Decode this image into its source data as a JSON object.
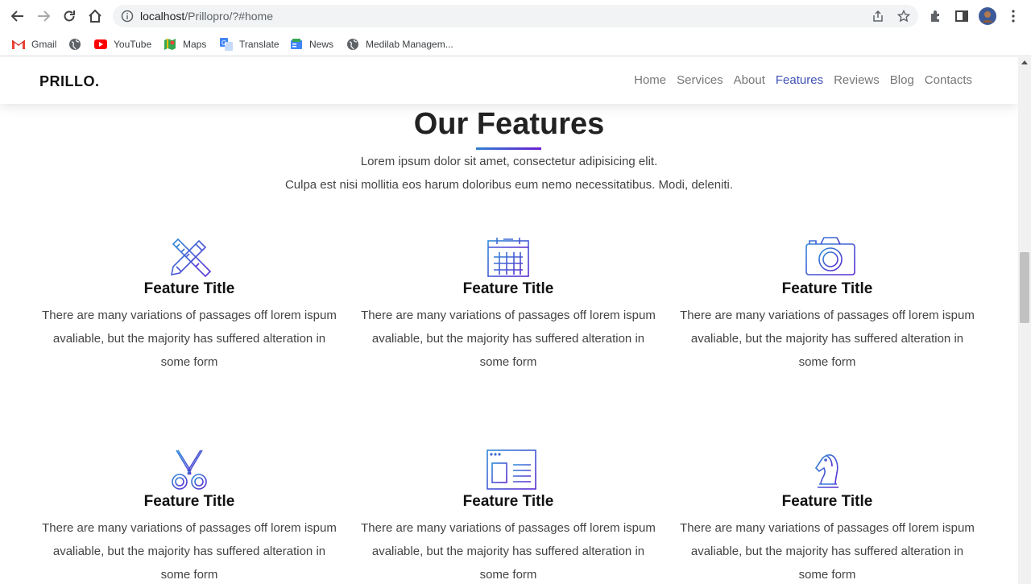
{
  "browser": {
    "url_host": "localhost",
    "url_path": "/Prillopro/?#home",
    "bookmarks": [
      {
        "label": "Gmail",
        "icon": "gmail-icon"
      },
      {
        "label": "",
        "icon": "globe-icon"
      },
      {
        "label": "YouTube",
        "icon": "youtube-icon"
      },
      {
        "label": "Maps",
        "icon": "maps-icon"
      },
      {
        "label": "Translate",
        "icon": "translate-icon"
      },
      {
        "label": "News",
        "icon": "news-icon"
      },
      {
        "label": "Medilab Managem...",
        "icon": "globe-icon"
      }
    ]
  },
  "site": {
    "logo": "PRILLO.",
    "nav": [
      {
        "label": "Home",
        "active": false
      },
      {
        "label": "Services",
        "active": false
      },
      {
        "label": "About",
        "active": false
      },
      {
        "label": "Features",
        "active": true
      },
      {
        "label": "Reviews",
        "active": false
      },
      {
        "label": "Blog",
        "active": false
      },
      {
        "label": "Contacts",
        "active": false
      }
    ],
    "accent_color": "#3f51b5"
  },
  "features_section": {
    "title": "Our Features",
    "subtitle_line1": "Lorem ipsum dolor sit amet, consectetur adipisicing elit.",
    "subtitle_line2": "Culpa est nisi mollitia eos harum doloribus eum nemo necessitatibus. Modi, deleniti.",
    "items": [
      {
        "icon": "design-tools-icon",
        "title": "Feature Title",
        "desc_line1": "There are many variations of passages off lorem ispum",
        "desc_line2": "avaliable, but the majority has suffered alteration in",
        "desc_line3": "some form"
      },
      {
        "icon": "calendar-icon",
        "title": "Feature Title",
        "desc_line1": "There are many variations of passages off lorem ispum",
        "desc_line2": "avaliable, but the majority has suffered alteration in",
        "desc_line3": "some form"
      },
      {
        "icon": "camera-icon",
        "title": "Feature Title",
        "desc_line1": "There are many variations of passages off lorem ispum",
        "desc_line2": "avaliable, but the majority has suffered alteration in",
        "desc_line3": "some form"
      },
      {
        "icon": "scissors-icon",
        "title": "Feature Title",
        "desc_line1": "There are many variations of passages off lorem ispum",
        "desc_line2": "avaliable, but the majority has suffered alteration in",
        "desc_line3": "some form"
      },
      {
        "icon": "browser-window-icon",
        "title": "Feature Title",
        "desc_line1": "There are many variations of passages off lorem ispum",
        "desc_line2": "avaliable, but the majority has suffered alteration in",
        "desc_line3": "some form"
      },
      {
        "icon": "chess-knight-icon",
        "title": "Feature Title",
        "desc_line1": "There are many variations of passages off lorem ispum",
        "desc_line2": "avaliable, but the majority has suffered alteration in",
        "desc_line3": "some form"
      }
    ]
  }
}
